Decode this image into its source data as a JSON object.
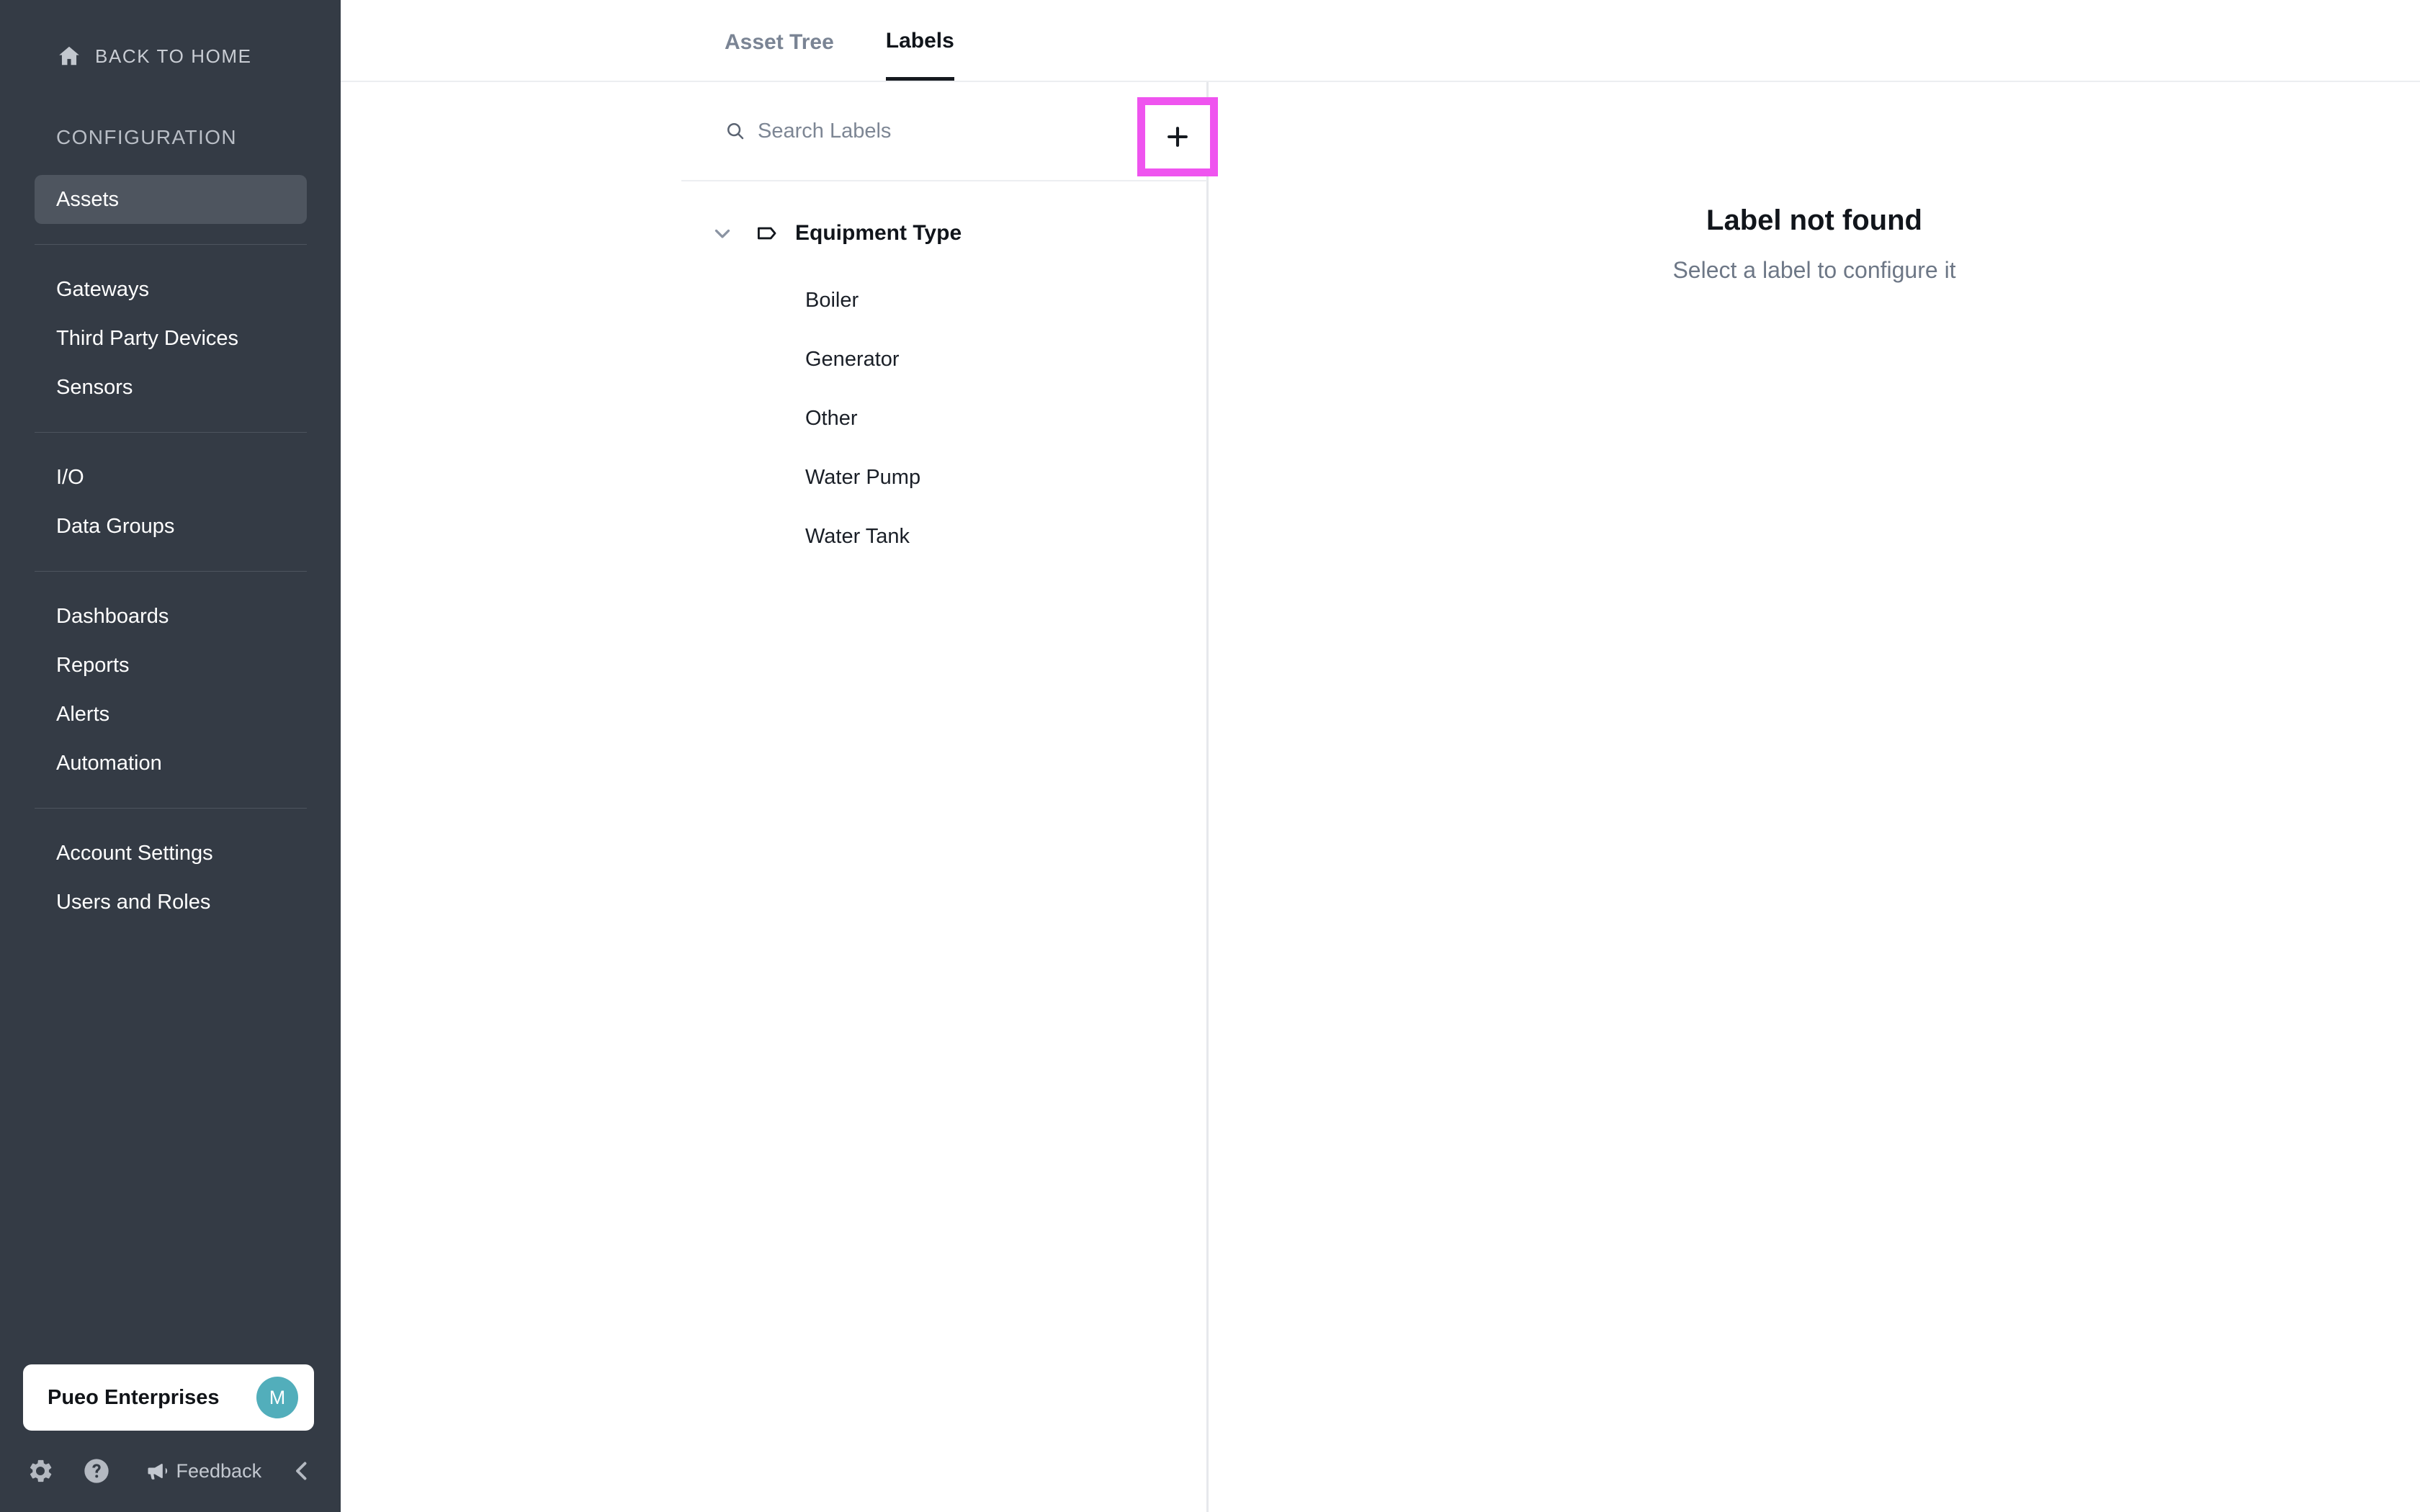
{
  "sidebar": {
    "back_home": {
      "label": "BACK TO HOME",
      "icon": "home-icon"
    },
    "section_title": "CONFIGURATION",
    "groups": [
      {
        "items": [
          {
            "label": "Assets",
            "active": true
          }
        ]
      },
      {
        "items": [
          {
            "label": "Gateways",
            "active": false
          },
          {
            "label": "Third Party Devices",
            "active": false
          },
          {
            "label": "Sensors",
            "active": false
          }
        ]
      },
      {
        "items": [
          {
            "label": "I/O",
            "active": false
          },
          {
            "label": "Data Groups",
            "active": false
          }
        ]
      },
      {
        "items": [
          {
            "label": "Dashboards",
            "active": false
          },
          {
            "label": "Reports",
            "active": false
          },
          {
            "label": "Alerts",
            "active": false
          },
          {
            "label": "Automation",
            "active": false
          }
        ]
      },
      {
        "items": [
          {
            "label": "Account Settings",
            "active": false
          },
          {
            "label": "Users and Roles",
            "active": false
          }
        ]
      }
    ],
    "org": {
      "name": "Pueo Enterprises",
      "avatar_initial": "M",
      "avatar_color": "#52aebb"
    },
    "footer": {
      "gear_icon": "gear-icon",
      "help_icon": "help-circle-icon",
      "feedback_icon": "megaphone-icon",
      "feedback_label": "Feedback",
      "collapse_icon": "chevron-left-icon"
    }
  },
  "tabs": [
    {
      "label": "Asset Tree",
      "active": false
    },
    {
      "label": "Labels",
      "active": true
    }
  ],
  "panel": {
    "search": {
      "placeholder": "Search Labels",
      "value": "",
      "icon": "search-icon"
    },
    "add_button": {
      "icon": "plus-icon",
      "highlight_color": "#ef54ef"
    },
    "tree": [
      {
        "label": "Equipment Type",
        "expanded": true,
        "chevron_icon": "chevron-down-icon",
        "tag_icon": "tag-icon",
        "children": [
          {
            "label": "Boiler"
          },
          {
            "label": "Generator"
          },
          {
            "label": "Other"
          },
          {
            "label": "Water Pump"
          },
          {
            "label": "Water Tank"
          }
        ]
      }
    ]
  },
  "empty_state": {
    "title": "Label not found",
    "subtitle": "Select a label to configure it"
  }
}
